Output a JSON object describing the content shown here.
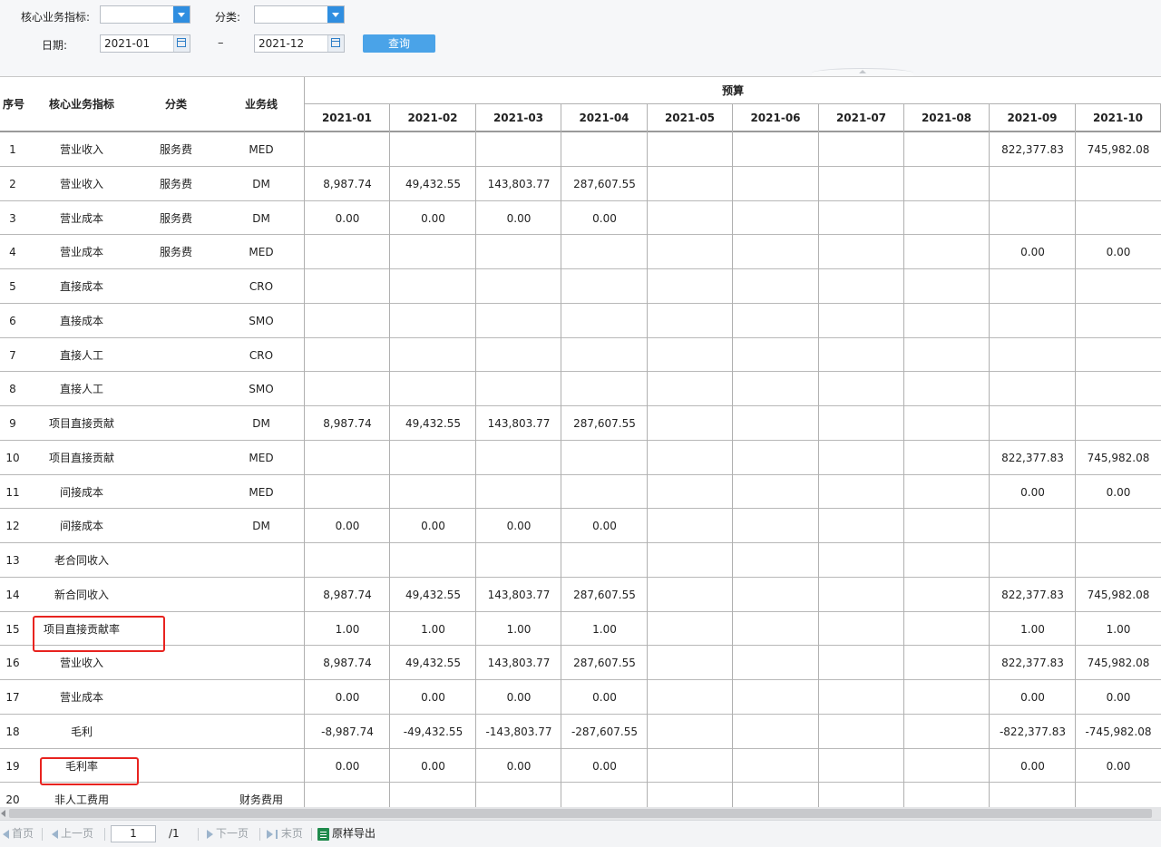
{
  "filters": {
    "indicator_label": "核心业务指标:",
    "indicator_value": "",
    "category_label": "分类:",
    "category_value": "",
    "date_label": "日期:",
    "date_from": "2021-01",
    "date_to": "2021-12",
    "dash": "–",
    "query_label": "查询"
  },
  "table": {
    "headers": [
      "序号",
      "核心业务指标",
      "分类",
      "业务线"
    ],
    "group_header": "预算",
    "months": [
      "2021-01",
      "2021-02",
      "2021-03",
      "2021-04",
      "2021-05",
      "2021-06",
      "2021-07",
      "2021-08",
      "2021-09",
      "2021-10"
    ],
    "rows": [
      {
        "no": "1",
        "indicator": "营业收入",
        "category": "服务费",
        "line": "MED",
        "m": [
          "",
          "",
          "",
          "",
          "",
          "",
          "",
          "",
          "822,377.83",
          "745,982.08"
        ]
      },
      {
        "no": "2",
        "indicator": "营业收入",
        "category": "服务费",
        "line": "DM",
        "m": [
          "8,987.74",
          "49,432.55",
          "143,803.77",
          "287,607.55",
          "",
          "",
          "",
          "",
          "",
          ""
        ]
      },
      {
        "no": "3",
        "indicator": "营业成本",
        "category": "服务费",
        "line": "DM",
        "m": [
          "0.00",
          "0.00",
          "0.00",
          "0.00",
          "",
          "",
          "",
          "",
          "",
          ""
        ]
      },
      {
        "no": "4",
        "indicator": "营业成本",
        "category": "服务费",
        "line": "MED",
        "m": [
          "",
          "",
          "",
          "",
          "",
          "",
          "",
          "",
          "0.00",
          "0.00"
        ]
      },
      {
        "no": "5",
        "indicator": "直接成本",
        "category": "",
        "line": "CRO",
        "m": [
          "",
          "",
          "",
          "",
          "",
          "",
          "",
          "",
          "",
          ""
        ]
      },
      {
        "no": "6",
        "indicator": "直接成本",
        "category": "",
        "line": "SMO",
        "m": [
          "",
          "",
          "",
          "",
          "",
          "",
          "",
          "",
          "",
          ""
        ]
      },
      {
        "no": "7",
        "indicator": "直接人工",
        "category": "",
        "line": "CRO",
        "m": [
          "",
          "",
          "",
          "",
          "",
          "",
          "",
          "",
          "",
          ""
        ]
      },
      {
        "no": "8",
        "indicator": "直接人工",
        "category": "",
        "line": "SMO",
        "m": [
          "",
          "",
          "",
          "",
          "",
          "",
          "",
          "",
          "",
          ""
        ]
      },
      {
        "no": "9",
        "indicator": "项目直接贡献",
        "category": "",
        "line": "DM",
        "m": [
          "8,987.74",
          "49,432.55",
          "143,803.77",
          "287,607.55",
          "",
          "",
          "",
          "",
          "",
          ""
        ]
      },
      {
        "no": "10",
        "indicator": "项目直接贡献",
        "category": "",
        "line": "MED",
        "m": [
          "",
          "",
          "",
          "",
          "",
          "",
          "",
          "",
          "822,377.83",
          "745,982.08"
        ]
      },
      {
        "no": "11",
        "indicator": "间接成本",
        "category": "",
        "line": "MED",
        "m": [
          "",
          "",
          "",
          "",
          "",
          "",
          "",
          "",
          "0.00",
          "0.00"
        ]
      },
      {
        "no": "12",
        "indicator": "间接成本",
        "category": "",
        "line": "DM",
        "m": [
          "0.00",
          "0.00",
          "0.00",
          "0.00",
          "",
          "",
          "",
          "",
          "",
          ""
        ]
      },
      {
        "no": "13",
        "indicator": "老合同收入",
        "category": "",
        "line": "",
        "m": [
          "",
          "",
          "",
          "",
          "",
          "",
          "",
          "",
          "",
          ""
        ]
      },
      {
        "no": "14",
        "indicator": "新合同收入",
        "category": "",
        "line": "",
        "m": [
          "8,987.74",
          "49,432.55",
          "143,803.77",
          "287,607.55",
          "",
          "",
          "",
          "",
          "822,377.83",
          "745,982.08"
        ]
      },
      {
        "no": "15",
        "indicator": "项目直接贡献率",
        "category": "",
        "line": "",
        "m": [
          "1.00",
          "1.00",
          "1.00",
          "1.00",
          "",
          "",
          "",
          "",
          "1.00",
          "1.00"
        ]
      },
      {
        "no": "16",
        "indicator": "营业收入",
        "category": "",
        "line": "",
        "m": [
          "8,987.74",
          "49,432.55",
          "143,803.77",
          "287,607.55",
          "",
          "",
          "",
          "",
          "822,377.83",
          "745,982.08"
        ]
      },
      {
        "no": "17",
        "indicator": "营业成本",
        "category": "",
        "line": "",
        "m": [
          "0.00",
          "0.00",
          "0.00",
          "0.00",
          "",
          "",
          "",
          "",
          "0.00",
          "0.00"
        ]
      },
      {
        "no": "18",
        "indicator": "毛利",
        "category": "",
        "line": "",
        "m": [
          "-8,987.74",
          "-49,432.55",
          "-143,803.77",
          "-287,607.55",
          "",
          "",
          "",
          "",
          "-822,377.83",
          "-745,982.08"
        ]
      },
      {
        "no": "19",
        "indicator": "毛利率",
        "category": "",
        "line": "",
        "m": [
          "0.00",
          "0.00",
          "0.00",
          "0.00",
          "",
          "",
          "",
          "",
          "0.00",
          "0.00"
        ]
      },
      {
        "no": "20",
        "indicator": "非人工费用",
        "category": "",
        "line": "财务费用",
        "m": [
          "",
          "",
          "",
          "",
          "",
          "",
          "",
          "",
          "",
          ""
        ]
      }
    ]
  },
  "pager": {
    "first": "首页",
    "prev": "上一页",
    "page_value": "1",
    "total": "/1",
    "next": "下一页",
    "last": "末页",
    "export": "原样导出"
  },
  "colors": {
    "accent": "#4aa3e8",
    "highlight": "#e8231f"
  }
}
